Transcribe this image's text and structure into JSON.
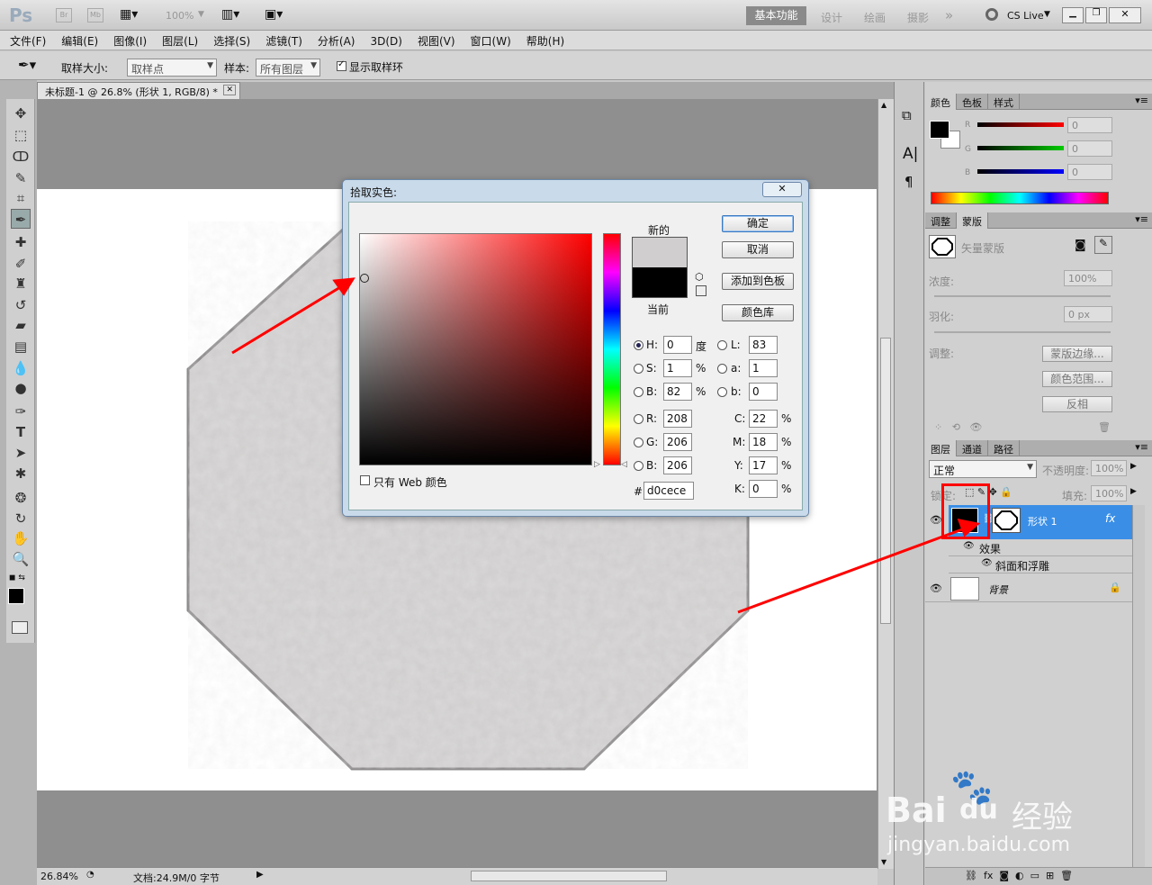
{
  "appbar": {
    "logo": "Ps",
    "br": "Br",
    "mb": "Mb",
    "zoom": "100%",
    "workspaces": [
      "基本功能",
      "设计",
      "绘画",
      "摄影"
    ],
    "more": "»",
    "cslive": "CS Live"
  },
  "menu": [
    "文件(F)",
    "编辑(E)",
    "图像(I)",
    "图层(L)",
    "选择(S)",
    "滤镜(T)",
    "分析(A)",
    "3D(D)",
    "视图(V)",
    "窗口(W)",
    "帮助(H)"
  ],
  "options": {
    "sample_size_label": "取样大小:",
    "sample_size_value": "取样点",
    "sample_label": "样本:",
    "sample_value": "所有图层",
    "show_ring_label": "显示取样环"
  },
  "document": {
    "tab_title": "未标题-1 @ 26.8% (形状 1, RGB/8) *",
    "zoom": "26.84%",
    "doc_info": "文档:24.9M/0 字节"
  },
  "dialog": {
    "title": "拾取实色:",
    "ok": "确定",
    "cancel": "取消",
    "add_swatch": "添加到色板",
    "libraries": "颜色库",
    "new_label": "新的",
    "current_label": "当前",
    "new_color": "#d0cece",
    "current_color": "#000000",
    "web_only": "只有 Web 颜色",
    "hsb": [
      {
        "label": "H:",
        "value": "0",
        "unit": "度"
      },
      {
        "label": "S:",
        "value": "1",
        "unit": "%"
      },
      {
        "label": "B:",
        "value": "82",
        "unit": "%"
      }
    ],
    "rgb": [
      {
        "label": "R:",
        "value": "208"
      },
      {
        "label": "G:",
        "value": "206"
      },
      {
        "label": "B:",
        "value": "206"
      }
    ],
    "lab": [
      {
        "label": "L:",
        "value": "83"
      },
      {
        "label": "a:",
        "value": "1"
      },
      {
        "label": "b:",
        "value": "0"
      }
    ],
    "cmyk": [
      {
        "label": "C:",
        "value": "22",
        "unit": "%"
      },
      {
        "label": "M:",
        "value": "18",
        "unit": "%"
      },
      {
        "label": "Y:",
        "value": "17",
        "unit": "%"
      },
      {
        "label": "K:",
        "value": "0",
        "unit": "%"
      }
    ],
    "hex_label": "#",
    "hex": "d0cece"
  },
  "color_panel": {
    "tabs": [
      "颜色",
      "色板",
      "样式"
    ],
    "channels": [
      {
        "label": "R",
        "value": "0"
      },
      {
        "label": "G",
        "value": "0"
      },
      {
        "label": "B",
        "value": "0"
      }
    ]
  },
  "masks_panel": {
    "tabs": [
      "调整",
      "蒙版"
    ],
    "title": "矢量蒙版",
    "density_label": "浓度:",
    "density": "100%",
    "feather_label": "羽化:",
    "feather": "0 px",
    "refine_label": "调整:",
    "edge_btn": "蒙版边缘...",
    "range_btn": "颜色范围...",
    "invert_btn": "反相"
  },
  "layers_panel": {
    "tabs": [
      "图层",
      "通道",
      "路径"
    ],
    "blend": "正常",
    "opacity_label": "不透明度:",
    "opacity": "100%",
    "lock_label": "锁定:",
    "fill_label": "填充:",
    "fill": "100%",
    "layers": [
      {
        "name": "形状 1",
        "fx": "fx"
      },
      {
        "name": "效果"
      },
      {
        "name": "斜面和浮雕"
      },
      {
        "name": "背景"
      }
    ]
  },
  "watermark": {
    "brand": "Bai",
    "brand2": "du",
    "brand3": "经验",
    "url": "jingyan.baidu.com"
  },
  "colors": {
    "accent": "#3a8ee6",
    "highlight": "#ff0000"
  }
}
